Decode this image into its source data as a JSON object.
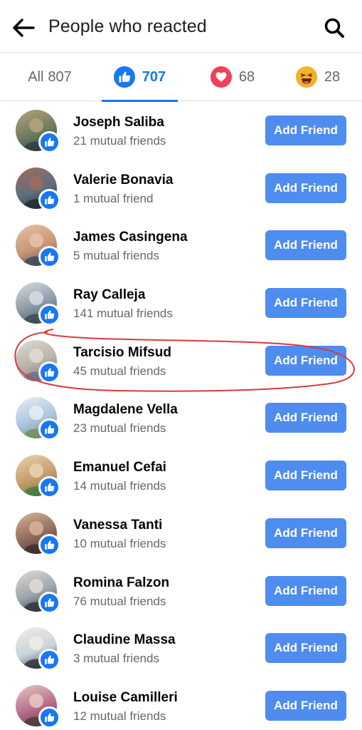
{
  "header": {
    "title": "People who reacted",
    "back_icon": "arrow-left-icon",
    "search_icon": "search-icon"
  },
  "tabs": [
    {
      "label": "All",
      "count": "807",
      "icon": null,
      "active": false
    },
    {
      "label": "",
      "count": "707",
      "icon": "like-icon",
      "active": true
    },
    {
      "label": "",
      "count": "68",
      "icon": "love-icon",
      "active": false
    },
    {
      "label": "",
      "count": "28",
      "icon": "haha-icon",
      "active": false
    }
  ],
  "colors": {
    "accent": "#1877f2",
    "button": "#4f8cf0",
    "love": "#f33e58",
    "haha": "#f7b125",
    "highlight_circle": "#d93b3b"
  },
  "people": [
    {
      "name": "Joseph Saliba",
      "mutual": "21 mutual friends",
      "button": "Add Friend",
      "reaction_icon": "like-icon"
    },
    {
      "name": "Valerie Bonavia",
      "mutual": "1 mutual friend",
      "button": "Add Friend",
      "reaction_icon": "like-icon"
    },
    {
      "name": "James Casingena",
      "mutual": "5 mutual friends",
      "button": "Add Friend",
      "reaction_icon": "like-icon"
    },
    {
      "name": "Ray Calleja",
      "mutual": "141 mutual friends",
      "button": "Add Friend",
      "reaction_icon": "like-icon"
    },
    {
      "name": "Tarcisio Mifsud",
      "mutual": "45 mutual friends",
      "button": "Add Friend",
      "reaction_icon": "like-icon"
    },
    {
      "name": "Magdalene Vella",
      "mutual": "23 mutual friends",
      "button": "Add Friend",
      "reaction_icon": "like-icon"
    },
    {
      "name": "Emanuel Cefai",
      "mutual": "14 mutual friends",
      "button": "Add Friend",
      "reaction_icon": "like-icon"
    },
    {
      "name": "Vanessa Tanti",
      "mutual": "10 mutual friends",
      "button": "Add Friend",
      "reaction_icon": "like-icon"
    },
    {
      "name": "Romina Falzon",
      "mutual": "76 mutual friends",
      "button": "Add Friend",
      "reaction_icon": "like-icon"
    },
    {
      "name": "Claudine Massa",
      "mutual": "3 mutual friends",
      "button": "Add Friend",
      "reaction_icon": "like-icon"
    },
    {
      "name": "Louise Camilleri",
      "mutual": "12 mutual friends",
      "button": "Add Friend",
      "reaction_icon": "like-icon"
    }
  ]
}
